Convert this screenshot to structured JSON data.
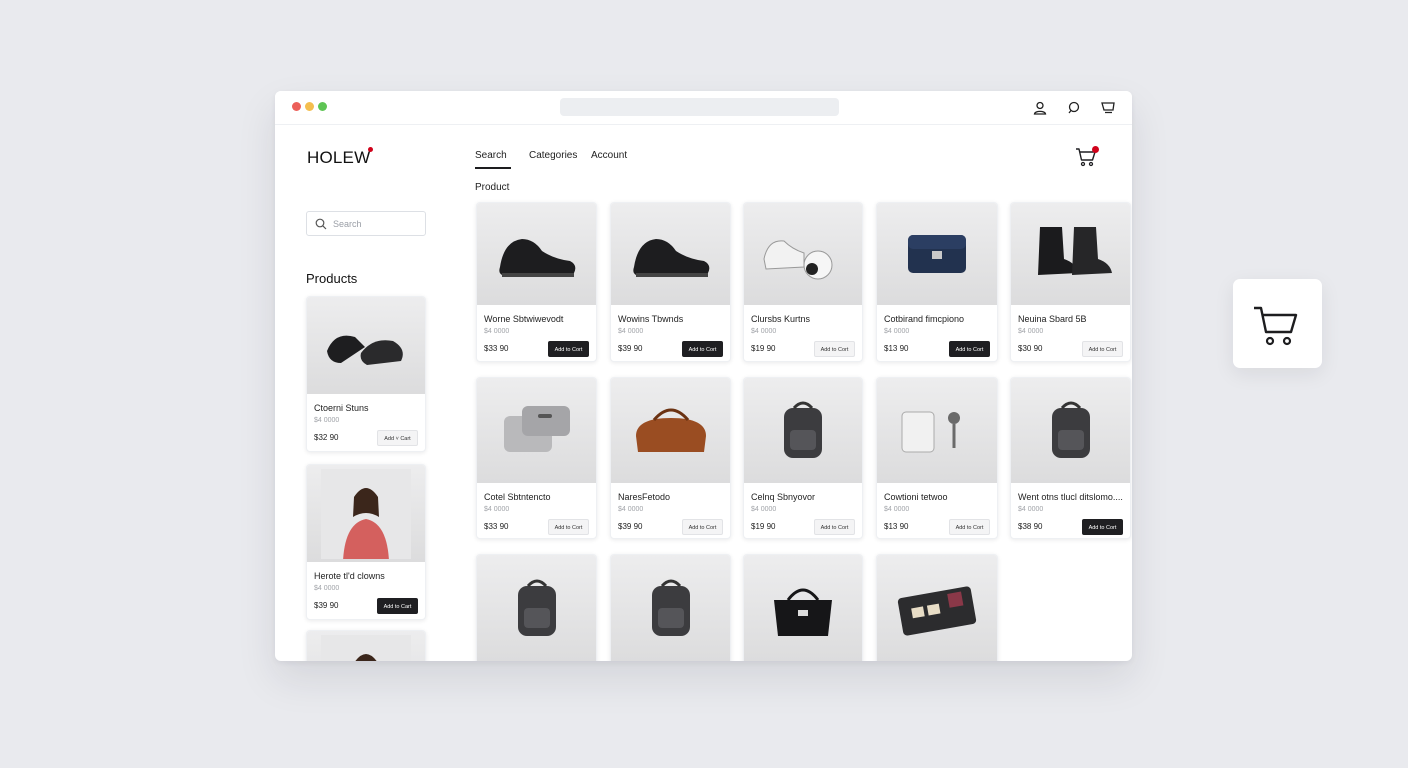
{
  "browser": {
    "window_dots": [
      "#ec5f59",
      "#f4be4f",
      "#5ec454"
    ]
  },
  "brand": {
    "name": "HOLEW",
    "accent": "#d0021b"
  },
  "nav": {
    "search": "Search",
    "categories": "Categories",
    "account": "Account"
  },
  "section_label": "Product",
  "sidebar": {
    "search_placeholder": "Search",
    "title": "Products",
    "items": [
      {
        "name": "Ctoerni Stuns",
        "sub": "$4 0000",
        "price": "$32 90",
        "button": "Add ˅ Cart",
        "button_style": "light",
        "icon": "loafers-image"
      },
      {
        "name": "Herote tl'd clowns",
        "sub": "$4 0000",
        "price": "$39 90",
        "button": "Add to Cart",
        "button_style": "dark",
        "icon": "model-portrait-image"
      },
      {
        "name": "",
        "sub": "",
        "price": "",
        "button": "",
        "button_style": "light",
        "icon": "model-portrait-image"
      }
    ]
  },
  "products": [
    {
      "name": "Worne Sbtwiwevodt",
      "sub": "$4 0000",
      "price": "$33 90",
      "button": "Add to Cort",
      "button_style": "dark",
      "icon": "shoes-image"
    },
    {
      "name": "Wowins Tbwnds",
      "sub": "$4 0000",
      "price": "$39 90",
      "button": "Add to Cort",
      "button_style": "dark",
      "icon": "shoes-image"
    },
    {
      "name": "Clursbs Kurtns",
      "sub": "$4 0000",
      "price": "$19 90",
      "button": "Add to Cort",
      "button_style": "light",
      "icon": "sneakers-image"
    },
    {
      "name": "Cotbirand fimcpiono",
      "sub": "$4 0000",
      "price": "$13 90",
      "button": "Add to Cort",
      "button_style": "dark",
      "icon": "clutch-bag-image"
    },
    {
      "name": "Neuina Sbard 5B",
      "sub": "$4 0000",
      "price": "$30 90",
      "button": "Add to Cort",
      "button_style": "light",
      "icon": "boots-image"
    },
    {
      "name": "Cotel Sbtntencto",
      "sub": "$4 0000",
      "price": "$33 90",
      "button": "Add to Cort",
      "button_style": "light",
      "icon": "luggage-image"
    },
    {
      "name": "NaresFetodo",
      "sub": "$4 0000",
      "price": "$39 90",
      "button": "Add to Cort",
      "button_style": "light",
      "icon": "duffel-bag-image"
    },
    {
      "name": "Celnq Sbnyovor",
      "sub": "$4 0000",
      "price": "$19 90",
      "button": "Add to Cort",
      "button_style": "light",
      "icon": "backpack-image"
    },
    {
      "name": "Cowtioni tetwoo",
      "sub": "$4 0000",
      "price": "$13 90",
      "button": "Add to Cort",
      "button_style": "light",
      "icon": "gadget-image"
    },
    {
      "name": "Went otns tlucl ditslomo....",
      "sub": "$4 0000",
      "price": "$38 90",
      "button": "Add to Cort",
      "button_style": "dark",
      "icon": "backpack-image"
    },
    {
      "name": "",
      "sub": "",
      "price": "",
      "button": "",
      "button_style": "light",
      "icon": "backpack-image"
    },
    {
      "name": "",
      "sub": "",
      "price": "",
      "button": "",
      "button_style": "light",
      "icon": "backpack-image"
    },
    {
      "name": "",
      "sub": "",
      "price": "",
      "button": "",
      "button_style": "light",
      "icon": "handbag-image"
    },
    {
      "name": "",
      "sub": "",
      "price": "",
      "button": "",
      "button_style": "light",
      "icon": "organizer-image"
    }
  ]
}
